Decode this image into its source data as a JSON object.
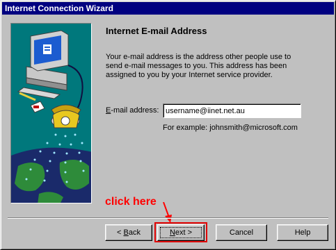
{
  "window": {
    "title": "Internet Connection Wizard"
  },
  "page": {
    "title": "Internet E-mail Address",
    "description": "Your e-mail address is the address other people use to send e-mail messages to you. This address has been assigned to you by your Internet service provider."
  },
  "email": {
    "label_accel": "E",
    "label_rest": "-mail address:",
    "value": "username@iinet.net.au",
    "example": "For example: johnsmith@microsoft.com"
  },
  "annotation": {
    "text": "click here",
    "color": "#ff0000"
  },
  "buttons": {
    "back_prefix": "< ",
    "back_accel": "B",
    "back_rest": "ack",
    "next_accel": "N",
    "next_rest": "ext >",
    "cancel": "Cancel",
    "help": "Help"
  },
  "colors": {
    "titlebar": "#000080",
    "face": "#c0c0c0",
    "illustration_bg": "#00787c"
  }
}
